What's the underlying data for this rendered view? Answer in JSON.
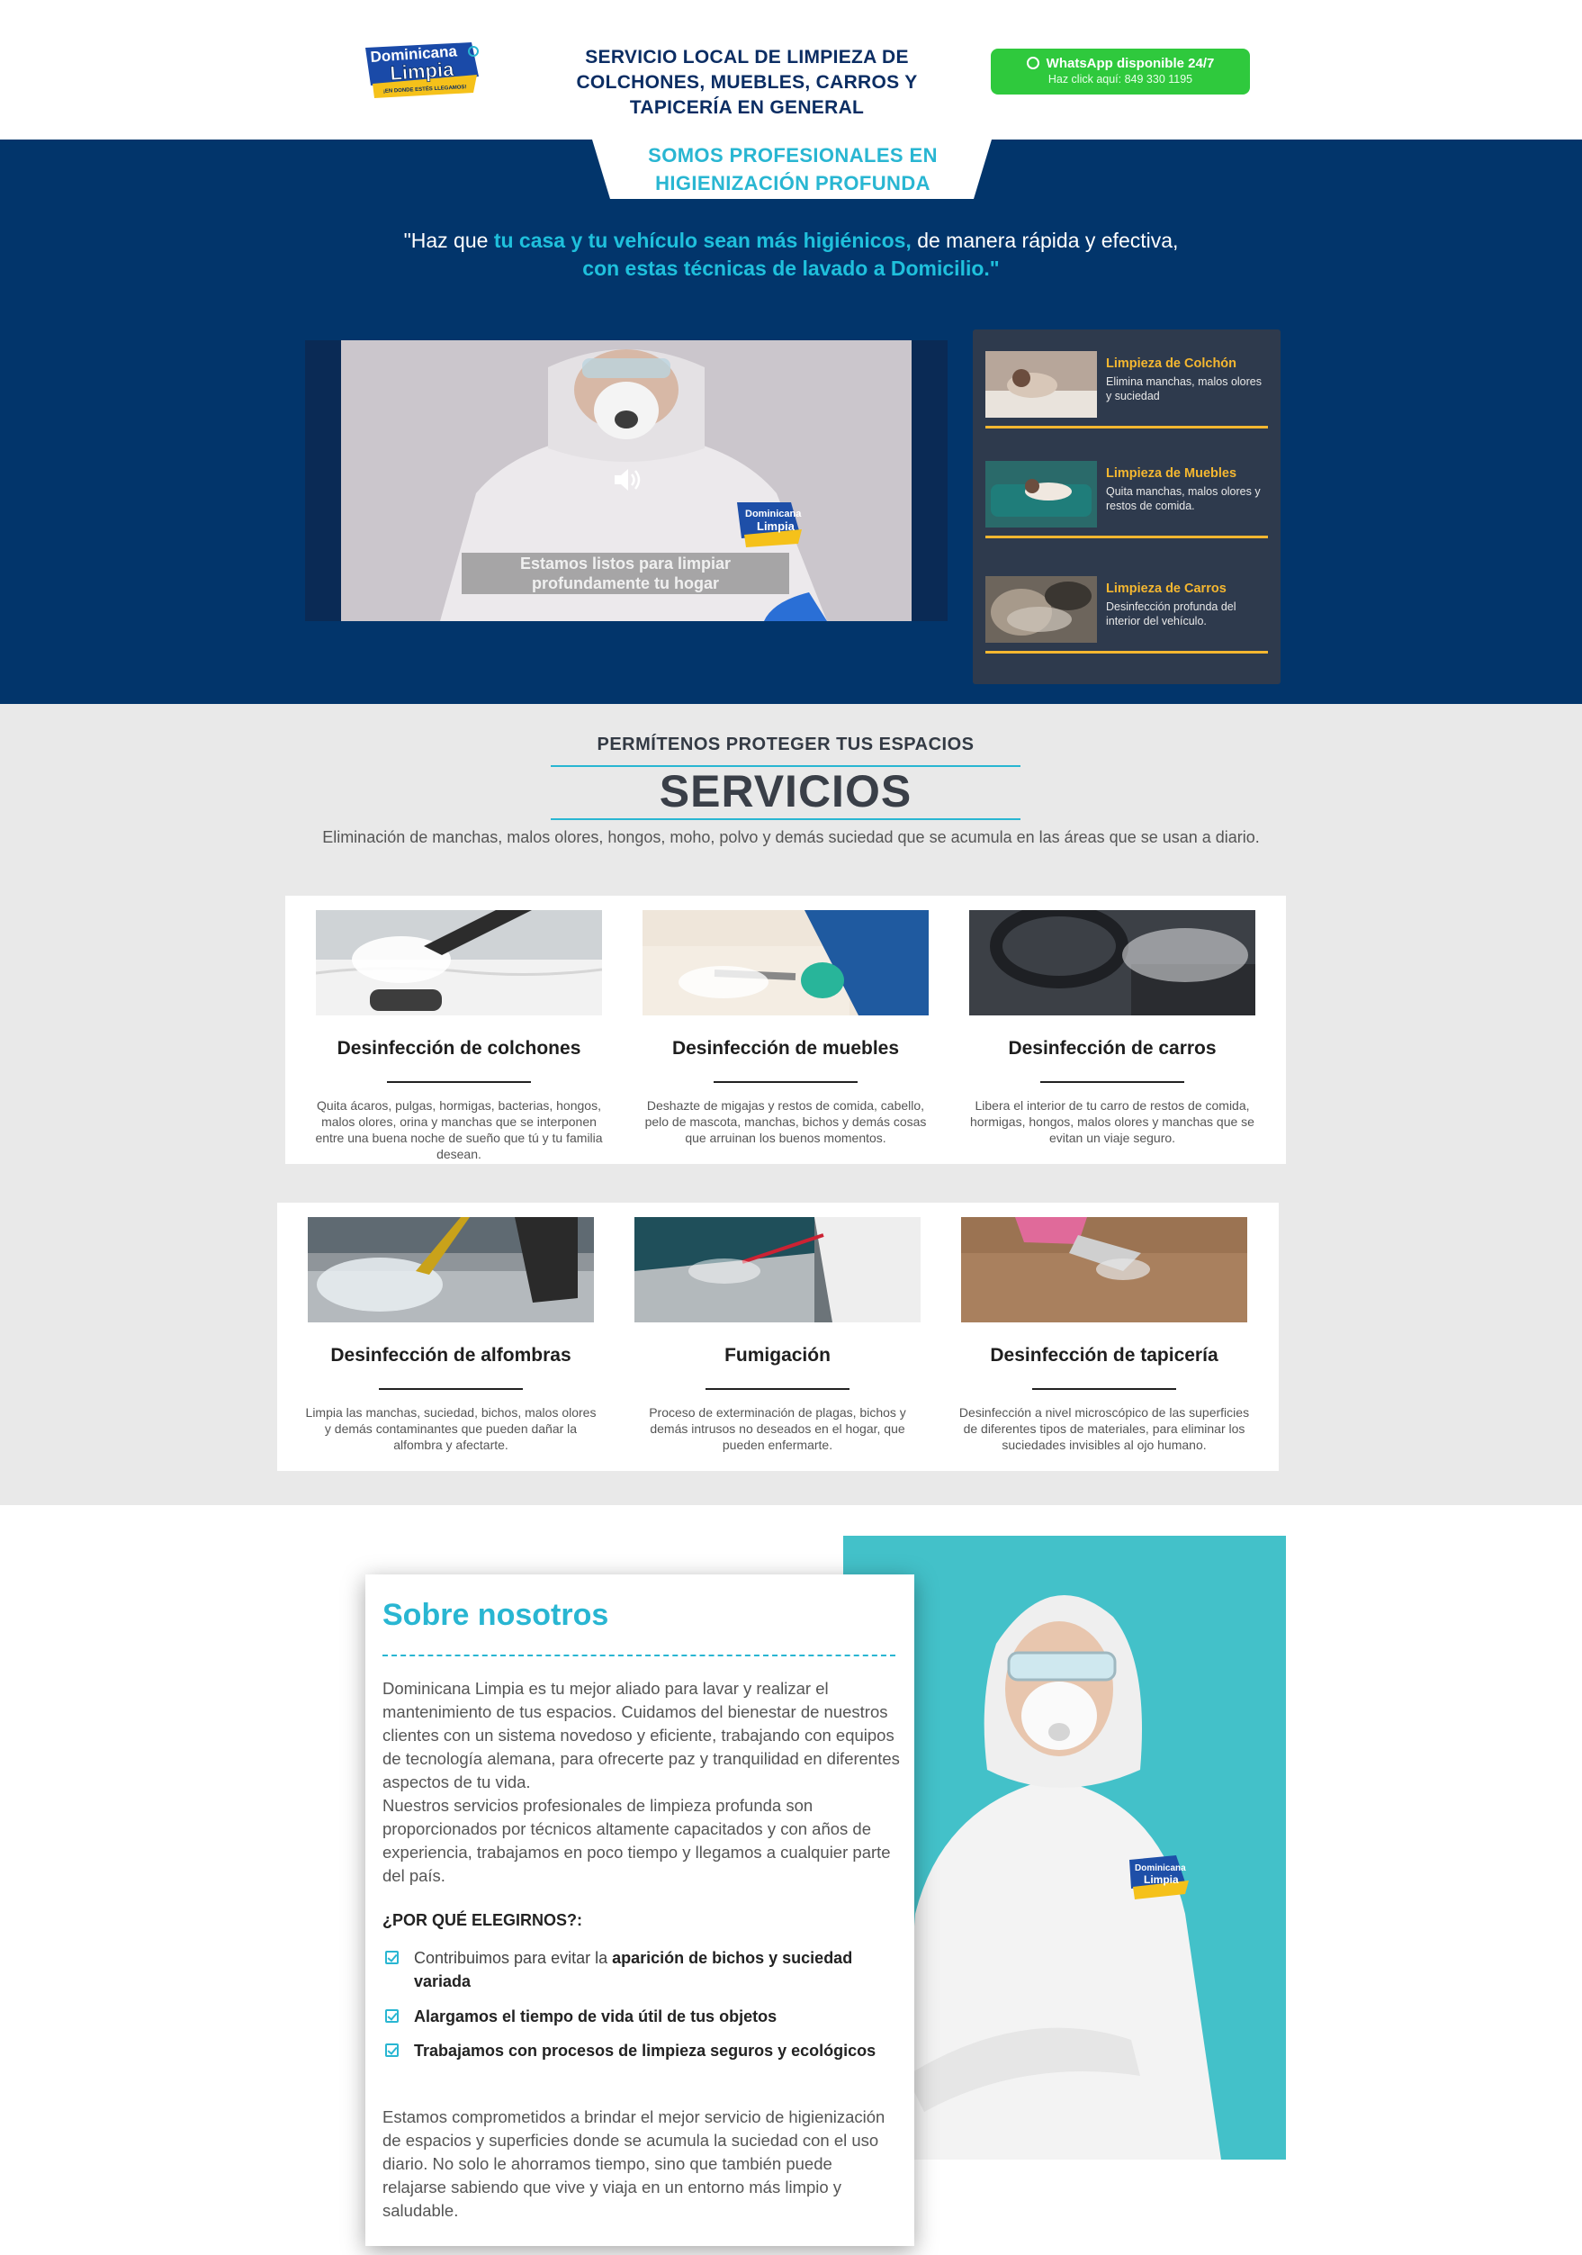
{
  "header": {
    "logo_text_1": "Dominicana",
    "logo_text_2": "Limpia",
    "logo_tagline": "¡EN DONDE ESTÉS LLEGAMOS!",
    "title": "SERVICIO LOCAL DE LIMPIEZA DE COLCHONES, MUEBLES, CARROS Y TAPICERÍA EN GENERAL",
    "whatsapp_label": "WhatsApp disponible 24/7",
    "whatsapp_sub": "Haz click aquí: 849 330 1195"
  },
  "hero": {
    "tab_text": "SOMOS PROFESIONALES EN HIGIENIZACIÓN PROFUNDA",
    "quote": {
      "part1": "\"Haz que ",
      "hl1": "tu casa y tu vehículo sean más higiénicos,",
      "part2": " de manera rápida y efectiva,",
      "hl2": "con estas técnicas de lavado a Domicilio.\""
    },
    "video_caption": "Estamos listos para limpiar profundamente tu hogar",
    "video_logo_1": "Dominicana",
    "video_logo_2": "Limpia",
    "side_services": [
      {
        "title": "Limpieza de Colchón",
        "desc": "Elimina manchas, malos olores y suciedad"
      },
      {
        "title": "Limpieza de Muebles",
        "desc": "Quita manchas, malos olores y restos de comida."
      },
      {
        "title": "Limpieza de Carros",
        "desc": "Desinfección profunda del interior del vehículo."
      }
    ]
  },
  "services": {
    "kicker": "PERMÍTENOS PROTEGER TUS ESPACIOS",
    "heading": "SERVICIOS",
    "intro": "Eliminación de manchas, malos olores, hongos, moho, polvo y demás suciedad que se acumula en las áreas que se usan a diario.",
    "cards": [
      {
        "title": "Desinfección de colchones",
        "desc": "Quita ácaros, pulgas, hormigas, bacterias, hongos, malos olores, orina y manchas que se interponen entre una buena noche de sueño que tú y tu familia desean."
      },
      {
        "title": "Desinfección de muebles",
        "desc": "Deshazte de migajas y restos de comida, cabello, pelo de mascota, manchas, bichos y demás cosas que arruinan los buenos momentos."
      },
      {
        "title": "Desinfección de carros",
        "desc": "Libera el interior de tu carro de restos de comida, hormigas, hongos, malos olores y manchas que se evitan un viaje seguro."
      },
      {
        "title": "Desinfección de alfombras",
        "desc": "Limpia las manchas, suciedad, bichos, malos olores y demás contaminantes que pueden dañar la alfombra y afectarte."
      },
      {
        "title": "Fumigación",
        "desc": "Proceso de exterminación de plagas, bichos y demás intrusos no deseados en el hogar, que pueden enfermarte."
      },
      {
        "title": "Desinfección de tapicería",
        "desc": "Desinfección a nivel microscópico de las superficies de diferentes tipos de materiales, para eliminar los suciedades invisibles al ojo humano."
      }
    ]
  },
  "about": {
    "title": "Sobre nosotros",
    "p1": "Dominicana Limpia es tu mejor aliado para lavar y realizar el mantenimiento de tus espacios. Cuidamos del bienestar de nuestros clientes con un sistema novedoso y eficiente, trabajando con equipos de tecnología alemana, para ofrecerte paz y tranquilidad en diferentes aspectos de tu vida.",
    "p2": "Nuestros servicios profesionales de limpieza profunda son proporcionados por técnicos altamente capacitados y con años de experiencia, trabajamos en poco tiempo y llegamos a cualquier parte del país.",
    "why_title": "¿POR QUÉ ELEGIRNOS?:",
    "check1_pre": "Contribuimos para evitar la ",
    "check1_bold": "aparición de bichos y suciedad variada",
    "check2_bold": "Alargamos el tiempo de vida útil de tus objetos",
    "check3_bold": "Trabajamos con procesos de limpieza seguros y ecológicos",
    "p3": "Estamos comprometidos a brindar el mejor servicio de higienización de espacios y superficies donde se acumula la suciedad con el uso diario. No solo le ahorramos tiempo, sino que también puede relajarse sabiendo que vive y viaja en un entorno más limpio y saludable.",
    "photo_logo_1": "Dominicana",
    "photo_logo_2": "Limpia"
  },
  "colors": {
    "navy": "#02356b",
    "accent_cyan": "#29b6d2",
    "gold": "#f5b730",
    "whatsapp_green": "#2fc93d"
  }
}
